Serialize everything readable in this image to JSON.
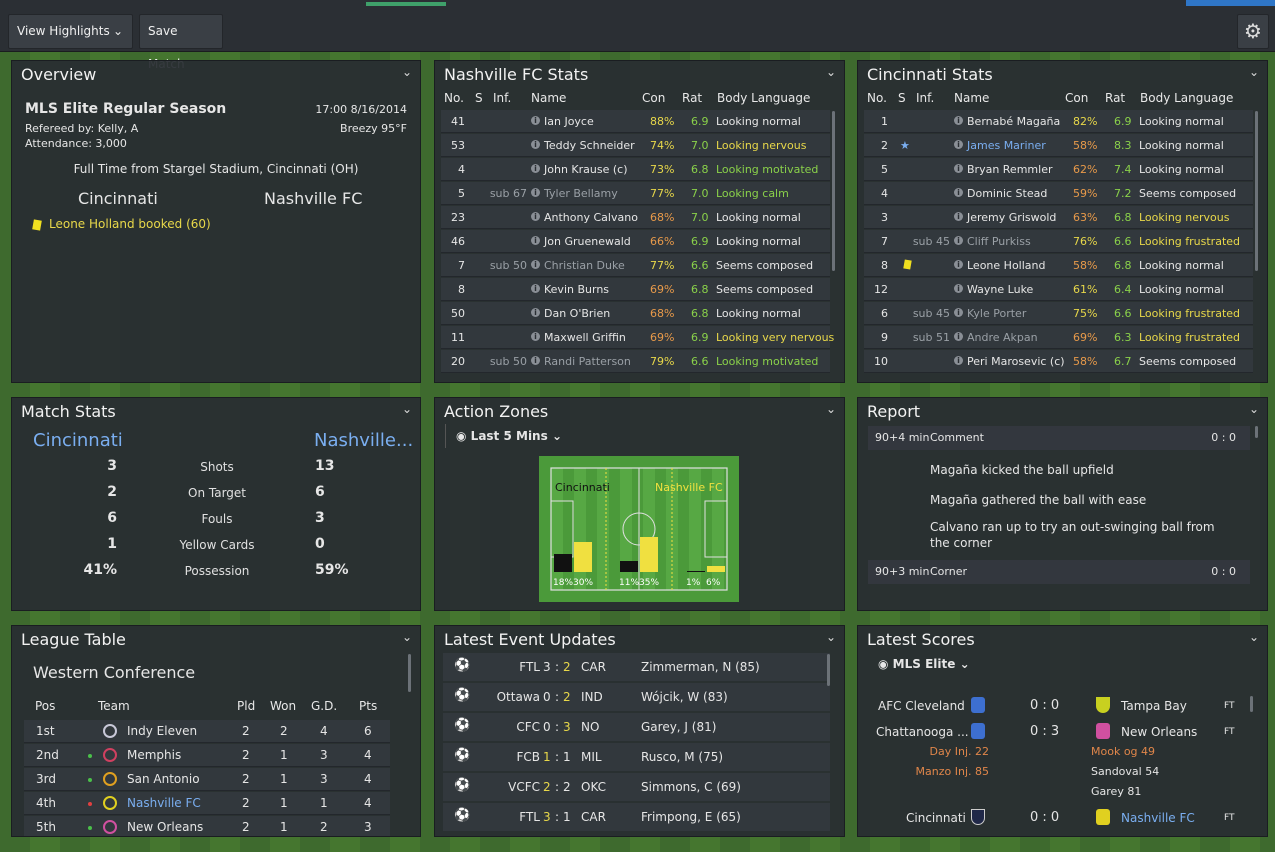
{
  "toolbar": {
    "view_highlights": "View Highlights",
    "save_match": "Save Match"
  },
  "overview": {
    "title": "Overview",
    "competition": "MLS Elite Regular Season",
    "datetime": "17:00 8/16/2014",
    "referee": "Refereed by: Kelly, A",
    "weather": "Breezy 95°F",
    "attendance": "Attendance: 3,000",
    "status": "Full Time from Stargel Stadium, Cincinnati (OH)",
    "home": "Cincinnati",
    "away": "Nashville FC",
    "event": "Leone Holland booked (60)"
  },
  "cols": {
    "no": "No.",
    "s": "S",
    "inf": "Inf.",
    "name": "Name",
    "con": "Con",
    "rat": "Rat",
    "body": "Body Language"
  },
  "nash": {
    "title": "Nashville FC Stats",
    "players": [
      {
        "no": "41",
        "inf": "",
        "name": "Ian Joyce",
        "con": "88%",
        "rat": "6.9",
        "body": "Looking normal",
        "cc": "yel",
        "bc": ""
      },
      {
        "no": "53",
        "inf": "",
        "name": "Teddy Schneider",
        "con": "74%",
        "rat": "7.0",
        "body": "Looking nervous",
        "cc": "yel",
        "bc": "yel"
      },
      {
        "no": "4",
        "inf": "",
        "name": "John Krause (c)",
        "con": "73%",
        "rat": "6.8",
        "body": "Looking motivated",
        "cc": "yel",
        "bc": "grn"
      },
      {
        "no": "5",
        "inf": "sub 67",
        "name": "Tyler Bellamy",
        "con": "77%",
        "rat": "7.0",
        "body": "Looking calm",
        "cc": "yel",
        "bc": "grn"
      },
      {
        "no": "23",
        "inf": "",
        "name": "Anthony Calvano",
        "con": "68%",
        "rat": "7.0",
        "body": "Looking normal",
        "cc": "org",
        "bc": ""
      },
      {
        "no": "46",
        "inf": "",
        "name": "Jon Gruenewald",
        "con": "66%",
        "rat": "6.9",
        "body": "Looking normal",
        "cc": "org",
        "bc": ""
      },
      {
        "no": "7",
        "inf": "sub 50",
        "name": "Christian Duke",
        "con": "77%",
        "rat": "6.6",
        "body": "Seems composed",
        "cc": "yel",
        "bc": ""
      },
      {
        "no": "8",
        "inf": "",
        "name": "Kevin Burns",
        "con": "69%",
        "rat": "6.8",
        "body": "Seems composed",
        "cc": "org",
        "bc": ""
      },
      {
        "no": "50",
        "inf": "",
        "name": "Dan O'Brien",
        "con": "68%",
        "rat": "6.8",
        "body": "Looking normal",
        "cc": "org",
        "bc": ""
      },
      {
        "no": "11",
        "inf": "",
        "name": "Maxwell Griffin",
        "con": "69%",
        "rat": "6.9",
        "body": "Looking very nervous",
        "cc": "org",
        "bc": "yel"
      },
      {
        "no": "20",
        "inf": "sub 50",
        "name": "Randi Patterson",
        "con": "79%",
        "rat": "6.6",
        "body": "Looking motivated",
        "cc": "yel",
        "bc": "grn"
      }
    ]
  },
  "cinc": {
    "title": "Cincinnati Stats",
    "players": [
      {
        "no": "1",
        "inf": "",
        "name": "Bernabé Magaña",
        "con": "82%",
        "rat": "6.9",
        "body": "Looking normal",
        "cc": "yel",
        "bc": ""
      },
      {
        "no": "2",
        "inf": "",
        "name": "James Mariner",
        "con": "58%",
        "rat": "8.3",
        "body": "Looking normal",
        "cc": "org",
        "bc": ""
      },
      {
        "no": "5",
        "inf": "",
        "name": "Bryan Remmler",
        "con": "62%",
        "rat": "7.4",
        "body": "Looking normal",
        "cc": "org",
        "bc": ""
      },
      {
        "no": "4",
        "inf": "",
        "name": "Dominic Stead",
        "con": "59%",
        "rat": "7.2",
        "body": "Seems composed",
        "cc": "org",
        "bc": ""
      },
      {
        "no": "3",
        "inf": "",
        "name": "Jeremy Griswold",
        "con": "63%",
        "rat": "6.8",
        "body": "Looking nervous",
        "cc": "org",
        "bc": "yel"
      },
      {
        "no": "7",
        "inf": "sub 45",
        "name": "Cliff Purkiss",
        "con": "76%",
        "rat": "6.6",
        "body": "Looking frustrated",
        "cc": "yel",
        "bc": "yel"
      },
      {
        "no": "8",
        "inf": "",
        "name": "Leone Holland",
        "con": "58%",
        "rat": "6.8",
        "body": "Looking normal",
        "cc": "org",
        "bc": ""
      },
      {
        "no": "12",
        "inf": "",
        "name": "Wayne Luke",
        "con": "61%",
        "rat": "6.4",
        "body": "Looking normal",
        "cc": "yel",
        "bc": ""
      },
      {
        "no": "6",
        "inf": "sub 45",
        "name": "Kyle Porter",
        "con": "75%",
        "rat": "6.6",
        "body": "Looking frustrated",
        "cc": "yel",
        "bc": "yel"
      },
      {
        "no": "9",
        "inf": "sub 51",
        "name": "Andre Akpan",
        "con": "69%",
        "rat": "6.3",
        "body": "Looking frustrated",
        "cc": "org",
        "bc": "yel"
      },
      {
        "no": "10",
        "inf": "",
        "name": "Peri Marosevic (c)",
        "con": "58%",
        "rat": "6.7",
        "body": "Seems composed",
        "cc": "org",
        "bc": ""
      }
    ]
  },
  "match_stats": {
    "title": "Match Stats",
    "home": "Cincinnati",
    "away": "Nashville...",
    "rows": [
      {
        "h": "3",
        "l": "Shots",
        "a": "13"
      },
      {
        "h": "2",
        "l": "On Target",
        "a": "6"
      },
      {
        "h": "6",
        "l": "Fouls",
        "a": "3"
      },
      {
        "h": "1",
        "l": "Yellow Cards",
        "a": "0"
      },
      {
        "h": "41%",
        "l": "Possession",
        "a": "59%"
      }
    ]
  },
  "action_zones": {
    "title": "Action Zones",
    "filter": "Last 5 Mins",
    "home_label": "Cincinnati",
    "away_label": "Nashville FC",
    "zones": [
      {
        "home": "18%",
        "away": "30%",
        "hv": 18,
        "av": 30
      },
      {
        "home": "11%",
        "away": "35%",
        "hv": 11,
        "av": 35
      },
      {
        "home": "1%",
        "away": "6%",
        "hv": 1,
        "av": 6
      }
    ]
  },
  "report": {
    "title": "Report",
    "e1_time": "90+4 min",
    "e1_type": "Comment",
    "e1_score": "0 : 0",
    "lines": [
      "Magaña kicked the ball upfield",
      "Magaña gathered the ball with ease",
      "Calvano ran up to try an out-swinging ball from the corner"
    ],
    "e2_time": "90+3 min",
    "e2_type": "Corner",
    "e2_score": "0 : 0"
  },
  "league": {
    "title": "League Table",
    "conference": "Western Conference",
    "headers": {
      "pos": "Pos",
      "team": "Team",
      "pld": "Pld",
      "won": "Won",
      "gd": "G.D.",
      "pts": "Pts"
    },
    "rows": [
      {
        "pos": "1st",
        "team": "Indy Eleven",
        "pld": "2",
        "won": "2",
        "gd": "4",
        "pts": "6",
        "mv": "",
        "crest": "#c8c8d8"
      },
      {
        "pos": "2nd",
        "team": "Memphis",
        "pld": "2",
        "won": "1",
        "gd": "3",
        "pts": "4",
        "mv": "up",
        "crest": "#d04060"
      },
      {
        "pos": "3rd",
        "team": "San Antonio",
        "pld": "2",
        "won": "1",
        "gd": "3",
        "pts": "4",
        "mv": "up",
        "crest": "#e0a020"
      },
      {
        "pos": "4th",
        "team": "Nashville FC",
        "pld": "2",
        "won": "1",
        "gd": "1",
        "pts": "4",
        "mv": "down",
        "crest": "#e0d020"
      },
      {
        "pos": "5th",
        "team": "New Orleans",
        "pld": "2",
        "won": "1",
        "gd": "2",
        "pts": "3",
        "mv": "up",
        "crest": "#d050a0"
      }
    ]
  },
  "events": {
    "title": "Latest Event Updates",
    "rows": [
      {
        "home": "FTL",
        "hs": "3",
        "as": "2",
        "away": "CAR",
        "desc": "Zimmerman, N (85)",
        "hl": "a"
      },
      {
        "home": "Ottawa",
        "hs": "0",
        "as": "2",
        "away": "IND",
        "desc": "Wójcik, W (83)",
        "hl": "a"
      },
      {
        "home": "CFC",
        "hs": "0",
        "as": "3",
        "away": "NO",
        "desc": "Garey, J (81)",
        "hl": "a"
      },
      {
        "home": "FCB",
        "hs": "1",
        "as": "1",
        "away": "MIL",
        "desc": "Rusco, M (75)",
        "hl": "h"
      },
      {
        "home": "VCFC",
        "hs": "2",
        "as": "2",
        "away": "OKC",
        "desc": "Simmons, C (69)",
        "hl": "h"
      },
      {
        "home": "FTL",
        "hs": "3",
        "as": "1",
        "away": "CAR",
        "desc": "Frimpong, E (65)",
        "hl": "h"
      }
    ]
  },
  "scores": {
    "title": "Latest Scores",
    "filter": "MLS Elite",
    "m1": {
      "home": "AFC Cleveland",
      "score": "0 : 0",
      "away": "Tampa Bay",
      "ft": "FT"
    },
    "m2": {
      "home": "Chattanooga ...",
      "score": "0 : 3",
      "away": "New Orleans",
      "ft": "FT",
      "home_notes": [
        "Day Inj. 22",
        "Manzo Inj. 85"
      ],
      "away_notes": [
        "Mook og 49",
        "Sandoval 54",
        "Garey 81"
      ]
    },
    "m3": {
      "home": "Cincinnati",
      "score": "0 : 0",
      "away": "Nashville FC",
      "ft": "FT"
    }
  }
}
